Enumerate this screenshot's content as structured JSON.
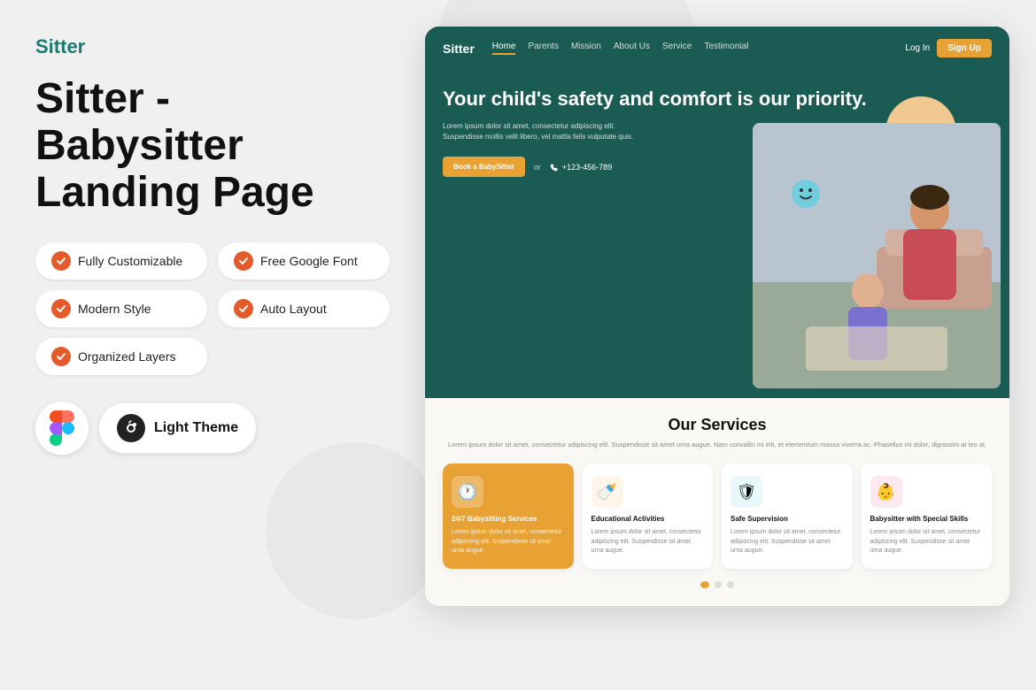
{
  "left": {
    "brand": "Sitter",
    "title": "Sitter - Babysitter Landing Page",
    "features": [
      {
        "label": "Fully Customizable",
        "id": "fully-customizable"
      },
      {
        "label": "Free Google Font",
        "id": "free-google-font"
      },
      {
        "label": "Modern Style",
        "id": "modern-style"
      },
      {
        "label": "Auto Layout",
        "id": "auto-layout"
      },
      {
        "label": "Organized Layers",
        "id": "organized-layers"
      }
    ],
    "theme_label": "Light Theme"
  },
  "preview": {
    "nav": {
      "brand": "Sitter",
      "links": [
        "Home",
        "Parents",
        "Mission",
        "About Us",
        "Service",
        "Testimonial"
      ],
      "active_link": "Home",
      "login": "Log In",
      "signup": "Sign Up"
    },
    "hero": {
      "title": "Your child's safety and comfort is our priority.",
      "description": "Lorem ipsum dolor sit amet, consectetur adipiscing elit. Suspendisse mollis velit libero, vel mattis felis vulputate quis.",
      "cta_button": "Book a BabySitter",
      "or_text": "or",
      "phone": "+123-456-789"
    },
    "services": {
      "title": "Our Services",
      "description": "Lorem ipsum dolor sit amet, consectetur adipiscing elit. Suspendisse sit amet urna augue. Nam convallis mi elit, et elementum massa viverra ac. Phasellus mi dolor, dignissim at leo at.",
      "cards": [
        {
          "icon": "🕐",
          "icon_color": "#e8a234",
          "name": "24/7 Babysitting Services",
          "text": "Lorem ipsum dolor sit amet, consectetur adipiscing elit. Suspendisse sit amet urna augue.",
          "active": true
        },
        {
          "icon": "🍼",
          "icon_color": "#e8a234",
          "name": "Educational Activities",
          "text": "Lorem ipsum dolor sit amet, consectetur adipiscing elit. Suspendisse sit amet urna augue.",
          "active": false
        },
        {
          "icon": "🛡",
          "icon_color": "#4ec9d4",
          "name": "Safe Supervision",
          "text": "Lorem ipsum dolor sit amet, consectetur adipiscing elit. Suspendisse sit amet urna augue.",
          "active": false
        },
        {
          "icon": "👶",
          "icon_color": "#e87a9a",
          "name": "Babysitter with Special Skills",
          "text": "Lorem ipsum dolor sit amet, consectetur adipiscing elit. Suspendisse sit amet urna augue.",
          "active": false
        }
      ],
      "dots": [
        true,
        false,
        false
      ]
    }
  },
  "colors": {
    "teal": "#1a5c54",
    "orange": "#e8a234",
    "red_check": "#e55a2b",
    "brand_teal": "#1a7a70"
  }
}
